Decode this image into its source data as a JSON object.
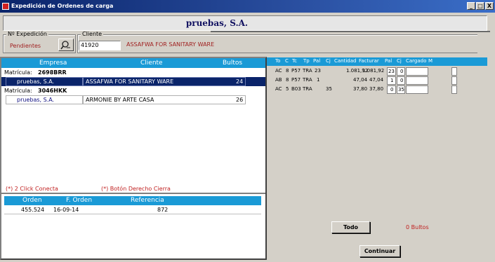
{
  "window": {
    "title": "Expedición de Ordenes de carga",
    "controls": [
      "_",
      "□",
      "X"
    ]
  },
  "company": {
    "name": "pruebas, S.A."
  },
  "expedicion": {
    "legend": "Nº Expedición",
    "status": "Pendientes"
  },
  "cliente": {
    "legend": "Cliente",
    "code": "41920",
    "name": "ASSAFWA FOR SANITARY WARE"
  },
  "grid": {
    "columns": [
      "To",
      "C",
      "Tc",
      "Tp",
      "Pal",
      "Cj",
      "Cantidad",
      "Facturar",
      "Pal",
      "Cj",
      "Cargado",
      "M"
    ],
    "rows": [
      {
        "to": "AC",
        "c": "8",
        "tc": "P57",
        "tp": "TRA",
        "pal": "23",
        "cj": "",
        "cantidad": "1.081,92",
        "facturar": "1.081,92",
        "pal2": "23",
        "cj2": "0",
        "cargado": "",
        "m": ""
      },
      {
        "to": "AB",
        "c": "8",
        "tc": "P57",
        "tp": "TRA",
        "pal": "1",
        "cj": "",
        "cantidad": "47,04",
        "facturar": "47,04",
        "pal2": "1",
        "cj2": "0",
        "cargado": "",
        "m": ""
      },
      {
        "to": "AC",
        "c": "5",
        "tc": "B03",
        "tp": "TRA",
        "pal": "",
        "cj": "35",
        "cantidad": "37,80",
        "facturar": "37,80",
        "pal2": "0",
        "cj2": "35",
        "cargado": "",
        "m": ""
      }
    ]
  },
  "popup": {
    "columns": {
      "empresa": "Empresa",
      "cliente": "Cliente",
      "bultos": "Bultos"
    },
    "groups": [
      {
        "matricula_label": "Matrícula:",
        "matricula": "2698BRR",
        "row": {
          "empresa": "pruebas, S.A.",
          "cliente": "ASSAFWA FOR SANITARY WARE",
          "bultos": "24"
        }
      },
      {
        "matricula_label": "Matrícula:",
        "matricula": "3046HKK",
        "row": {
          "empresa": "pruebas, S.A.",
          "cliente": "ARMONIE BY ARTE CASA",
          "bultos": "26"
        }
      }
    ],
    "hint_left": "(*) 2 Click Conecta",
    "hint_right": "(*) Botón Derecho Cierra",
    "orders": {
      "columns": {
        "orden": "Orden",
        "fecha": "F. Orden",
        "referencia": "Referencia"
      },
      "row": {
        "orden": "455.524",
        "fecha": "16-09-14",
        "referencia": "872"
      }
    }
  },
  "footer": {
    "todo_label": "Todo",
    "bultos_total": "0 Bultos",
    "continuar_label": "Continuar"
  },
  "colors": {
    "title_bar": "#0a246a",
    "grid_header": "#1a9ad6",
    "selection": "#0a246a",
    "accent_text": "#c02020"
  }
}
